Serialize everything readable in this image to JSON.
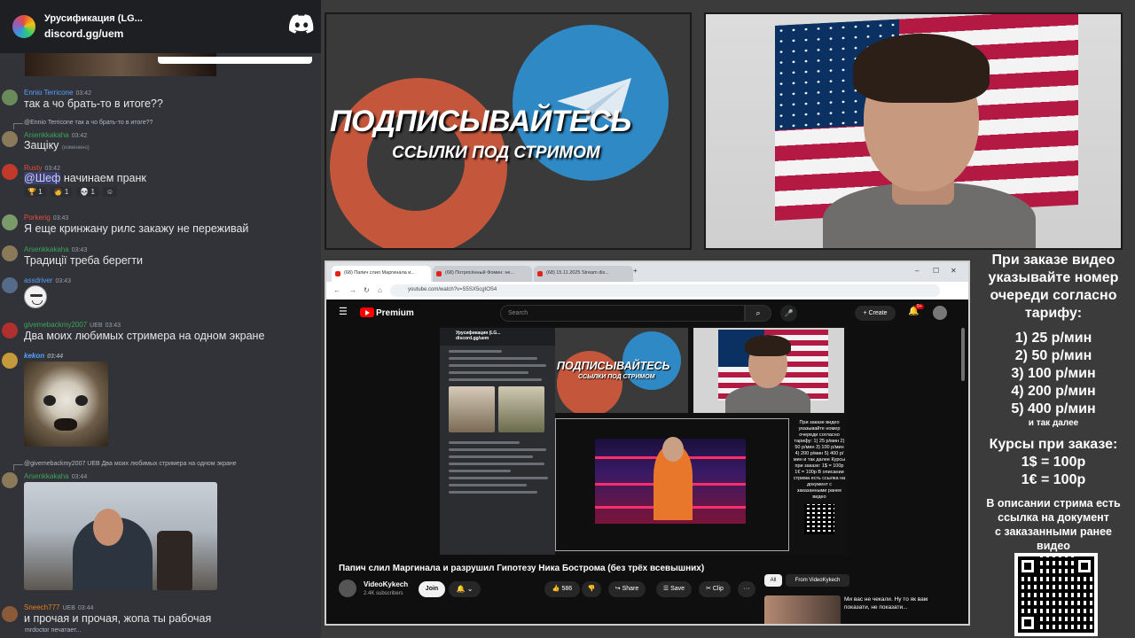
{
  "discord": {
    "server_name": "Урусификация (LG...",
    "invite": "discord.gg/uem",
    "messages": [
      {
        "user": "Ennio Terricone",
        "time": "03:42",
        "text": "так а чо брать-то в итоге??",
        "color": "#57a0ff"
      },
      {
        "reply_to": "@Ennio Terricone так а чо брать-то в итоге??",
        "user": "Arsenkkakaha",
        "time": "03:42",
        "text": "Защіку",
        "edited": "(изменено)",
        "color": "#3ba55c"
      },
      {
        "user": "Rusty",
        "time": "03:42",
        "text_mention": "@Шеф",
        "text": " начинаем пранк",
        "color": "#e74c3c",
        "reactions": [
          "1",
          "1",
          "1"
        ]
      },
      {
        "user": "Porkerig",
        "time": "03:43",
        "text": "Я еще кринжану рилс закажу не переживай",
        "color": "#e74c3c"
      },
      {
        "user": "Arsenkkakaha",
        "time": "03:43",
        "text": "Традиції треба берегти",
        "color": "#3ba55c"
      },
      {
        "user": "assdriver",
        "time": "03:43",
        "color": "#57a0ff"
      },
      {
        "user": "givemebackmy2007",
        "badge": "UEB",
        "time": "03:43",
        "text": "Два моих любимых стримера на одном экране",
        "color": "#3ba55c"
      },
      {
        "user": "kekon",
        "time": "03:44",
        "color": "#57a0ff"
      },
      {
        "reply_to": "@givemebackmy2007 UEB Два моих любимых стримера на одном экране",
        "user": "Arsenkkakaha",
        "time": "03:44",
        "color": "#3ba55c"
      },
      {
        "user": "Sneech777",
        "badge": "UEB",
        "time": "03:44",
        "text": "и прочая и прочая, жопа ты рабочая",
        "color": "#e67e22"
      }
    ],
    "typing": "mrdoctor печатает..."
  },
  "banner": {
    "title": "ПОДПИСЫВАЙТЕСЬ",
    "subtitle": "ССЫЛКИ ПОД СТРИМОМ"
  },
  "browser": {
    "tabs": [
      "(68) Папич слил Маргинала и...",
      "(68) Потрясённый Фомин: не...",
      "(68) 15.11.2025 Stream dis..."
    ],
    "url": "youtube.com/watch?v=S5SX5cgIOS4",
    "youtube": {
      "brand": "Premium",
      "search_placeholder": "Search",
      "create_label": "Create",
      "notif_count": "9+"
    },
    "video": {
      "title": "Папич слил Маргинала и разрушил Гипотезу Ника Бострома (без трёх всевышних)",
      "channel": "VideoKykech",
      "subscribers": "2.4K subscribers",
      "join": "Join",
      "likes": "586",
      "share": "Share",
      "save": "Save",
      "clip": "Clip",
      "more": "···",
      "inner_chat_title": "Урусификация (LG...",
      "inner_chat_sub": "discord.gg/uem",
      "inner_banner_title": "ПОДПИСЫВАЙТЕСЬ",
      "inner_banner_sub": "ССЫЛКИ ПОД СТРИМОМ",
      "inner_side_text": "При заказе видео указывайте номер очереди согласно тарифу: 1) 25 р/мин 2) 50 р/мин 3) 100 р/мин 4) 200 р/мин 5) 400 р/мин и так далее Курсы при заказе: 1$ = 100р 1€ = 100р В описании стрима есть ссылка на документ с заказанными ранее видео"
    },
    "chips": {
      "all": "All",
      "from": "From VideoKykech"
    },
    "recommend": {
      "title": "Ми вас не чекали. Ну то як вам показати, не показати..."
    }
  },
  "info": {
    "intro": [
      "При заказе видео",
      "указывайте номер",
      "очереди согласно",
      "тарифу:"
    ],
    "tariffs": [
      "1) 25 р/мин",
      "2) 50 р/мин",
      "3) 100 р/мин",
      "4) 200 р/мин",
      "5) 400 р/мин"
    ],
    "etc": "и так далее",
    "rates_title": "Курсы при заказе:",
    "rates": [
      "1$ = 100р",
      "1€ = 100р"
    ],
    "doc_note": [
      "В описании стрима есть",
      "ссылка на документ",
      "с заказанными ранее",
      "видео"
    ]
  }
}
